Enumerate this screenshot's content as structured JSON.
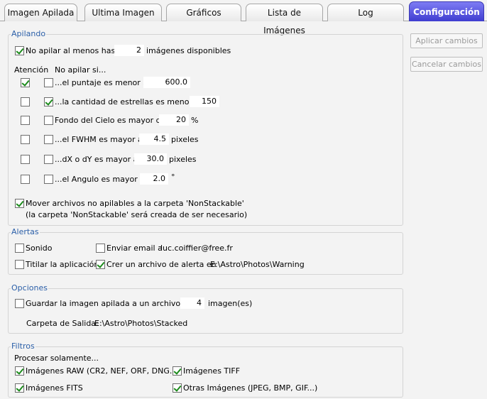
{
  "tabs": [
    {
      "label": "Imagen Apilada"
    },
    {
      "label": "Ultima Imagen"
    },
    {
      "label": "Gráficos"
    },
    {
      "label": "Lista de Imágenes"
    },
    {
      "label": "Log"
    },
    {
      "label": "Configuración",
      "active": true
    }
  ],
  "buttons": {
    "apply": "Aplicar cambios",
    "cancel": "Cancelar cambios"
  },
  "stacking": {
    "title": "Apilando",
    "no_stack_label": "No apilar al menos hasta",
    "no_stack_checked": true,
    "no_stack_value": "2",
    "no_stack_suffix": "imágenes disponibles",
    "col_attention": "Atención",
    "col_no_stack_if": "No apilar si...",
    "rows": [
      {
        "attention": true,
        "no_stack": false,
        "label": "...el puntaje es menor a",
        "value": "600.0",
        "unit": ""
      },
      {
        "attention": false,
        "no_stack": true,
        "label": "...la cantidad de estrellas es menor a",
        "value": "150",
        "unit": ""
      },
      {
        "attention": false,
        "no_stack": false,
        "label": "Fondo del Cielo es mayor que",
        "value": "20",
        "unit": "%"
      },
      {
        "attention": false,
        "no_stack": false,
        "label": "...el FWHM es mayor a",
        "value": "4.5",
        "unit": "pixeles"
      },
      {
        "attention": false,
        "no_stack": false,
        "label": "...dX o dY es mayor a",
        "value": "30.0",
        "unit": "pixeles"
      },
      {
        "attention": false,
        "no_stack": false,
        "label": "...el Angulo es mayor a",
        "value": "2.0",
        "unit": "°"
      }
    ],
    "move_checked": true,
    "move_label": "Mover archivos no apilables a la carpeta 'NonStackable'",
    "move_note": "(la carpeta 'NonStackable' será creada de ser necesario)"
  },
  "alerts": {
    "title": "Alertas",
    "sound_label": "Sonido",
    "sound_checked": false,
    "email_label": "Enviar email a",
    "email_checked": false,
    "email_value": "luc.coiffier@free.fr",
    "title_app_label": "Titilar la aplicación",
    "title_app_checked": false,
    "alert_file_label": "Crer un archivo de alerta en",
    "alert_file_checked": true,
    "alert_file_path": "E:\\Astro\\Photos\\Warning"
  },
  "options": {
    "title": "Opciones",
    "save_label": "Guardar la imagen apilada a un archivo cada",
    "save_checked": false,
    "save_value": "4",
    "save_suffix": "imagen(es)",
    "output_label": "Carpeta de Salida:",
    "output_path": "E:\\Astro\\Photos\\Stacked"
  },
  "filters": {
    "title": "Filtros",
    "process_label": "Procesar solamente...",
    "raw_label": "Imágenes RAW (CR2, NEF, ORF, DNG...)",
    "raw_checked": true,
    "tiff_label": "Imágenes TIFF",
    "tiff_checked": true,
    "fits_label": "Imágenes FITS",
    "fits_checked": true,
    "other_label": "Otras Imágenes (JPEG, BMP, GIF...)",
    "other_checked": true
  }
}
